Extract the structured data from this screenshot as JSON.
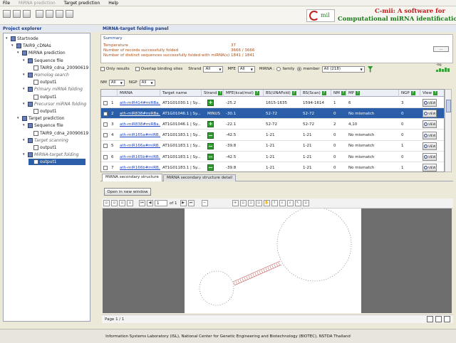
{
  "menu": [
    "File",
    "MiRNA prediction",
    "Target prediction",
    "Help"
  ],
  "menu_disabled": [
    false,
    true,
    false,
    false
  ],
  "toolbar_icons": [
    "new-project-icon",
    "open-project-icon",
    "save-project-icon",
    "document-icon",
    "document-icon",
    "document-icon",
    "document-icon"
  ],
  "logo": {
    "mark_text": "mil",
    "line1": "C-mii: A software for",
    "line2": "Computational miRNA identification"
  },
  "left_panel": {
    "title": "Project explorer",
    "tree": [
      {
        "label": "Startnode",
        "level": 0,
        "type": "folder",
        "twisty": "▾"
      },
      {
        "label": "TAIR9_cDNAs",
        "level": 1,
        "type": "folder",
        "twisty": "▾"
      },
      {
        "label": "MiRNA prediction",
        "level": 2,
        "type": "folder",
        "twisty": "▾"
      },
      {
        "label": "Sequence file",
        "level": 3,
        "type": "folder",
        "twisty": "▾"
      },
      {
        "label": "TAIR9_cdna_20090619",
        "level": 4,
        "type": "file",
        "twisty": ""
      },
      {
        "label": "Homolog search",
        "level": 3,
        "type": "folder",
        "twisty": "▾",
        "italic": true
      },
      {
        "label": "output1",
        "level": 4,
        "type": "file",
        "twisty": ""
      },
      {
        "label": "Primary miRNA folding",
        "level": 3,
        "type": "folder",
        "twisty": "▾",
        "italic": true
      },
      {
        "label": "output1",
        "level": 4,
        "type": "file",
        "twisty": ""
      },
      {
        "label": "Precursor miRNA folding",
        "level": 3,
        "type": "folder",
        "twisty": "▾",
        "italic": true
      },
      {
        "label": "output1",
        "level": 4,
        "type": "file",
        "twisty": ""
      },
      {
        "label": "Target prediction",
        "level": 2,
        "type": "folder",
        "twisty": "▾"
      },
      {
        "label": "Sequence file",
        "level": 3,
        "type": "folder",
        "twisty": "▾"
      },
      {
        "label": "TAIR9_cdna_20090619",
        "level": 4,
        "type": "file",
        "twisty": ""
      },
      {
        "label": "Target scanning",
        "level": 3,
        "type": "folder",
        "twisty": "▾",
        "italic": true
      },
      {
        "label": "output1",
        "level": 4,
        "type": "file",
        "twisty": ""
      },
      {
        "label": "MiRNA-target folding",
        "level": 3,
        "type": "folder",
        "twisty": "▾",
        "italic": true
      },
      {
        "label": "output1",
        "level": 4,
        "type": "file",
        "twisty": "",
        "selected": true
      }
    ]
  },
  "right_panel": {
    "title": "MiRNA-target folding panel",
    "summary": {
      "title": "Summary",
      "rows": [
        {
          "label": "Temperature",
          "value": "37"
        },
        {
          "label": "Number of records successfully folded",
          "value": "3666 / 3666"
        },
        {
          "label": "Number of distinct sequences successfully folded with miRNA(s)",
          "value": "1841 / 1841"
        }
      ],
      "more_button": "..."
    },
    "filters": {
      "only_results": "Only results",
      "overlap": "Overlap binding sites",
      "strand_label": "Strand",
      "strand_value": "All",
      "mfe_label": "MFE",
      "mfe_value": "All",
      "mirna_label": "MiRNA :",
      "family_label": "family",
      "member_label": "member",
      "member_value": "All (218)",
      "nm_label": "NM",
      "nm_value": "All",
      "ngp_label": "NGP",
      "ngp_value": "All",
      "stat_label": "-log"
    },
    "table": {
      "columns": [
        "",
        "MiRNA",
        "Target name",
        "Strand",
        "MFE(kcal/mol)",
        "BS(UNAFold)",
        "BS(Scan)",
        "NM",
        "MP",
        "NGP",
        "View"
      ],
      "rows": [
        {
          "idx": "1",
          "mirna": "ath-miR414#miRBa...",
          "target": "AT1G01030.1 | Sy...",
          "strand": "plus",
          "strand_text": "",
          "mfe": "-25.2",
          "bs_unafold": "1615-1635",
          "bs_scan": "1594-1614",
          "nm": "1",
          "mp": "6",
          "ngp": "3",
          "view": "VIEW"
        },
        {
          "idx": "2",
          "mirna": "ath-miR838#miRBa...",
          "target": "AT1G01046.1 | Sy...",
          "strand": "text",
          "strand_text": "MINUS",
          "mfe": "-30.1",
          "bs_unafold": "52-72",
          "bs_scan": "52-72",
          "nm": "0",
          "mp": "No mismatch",
          "ngp": "0",
          "view": "VIEW",
          "selected": true
        },
        {
          "idx": "3",
          "mirna": "ath-miR838#miRBa...",
          "target": "AT1G01046.1 | Sy...",
          "strand": "plus",
          "strand_text": "",
          "mfe": "-22.1",
          "bs_unafold": "52-72",
          "bs_scan": "52-72",
          "nm": "2",
          "mp": "4,10",
          "ngp": "0",
          "view": "VIEW"
        },
        {
          "idx": "4",
          "mirna": "ath-miR165a#miRB...",
          "target": "AT1G01183.1 | Sy...",
          "strand": "minus",
          "strand_text": "",
          "mfe": "-42.5",
          "bs_unafold": "1-21",
          "bs_scan": "1-21",
          "nm": "0",
          "mp": "No mismatch",
          "ngp": "0",
          "view": "VIEW"
        },
        {
          "idx": "5",
          "mirna": "ath-miR166a#miRB...",
          "target": "AT1G01183.1 | Sy...",
          "strand": "minus",
          "strand_text": "",
          "mfe": "-39.8",
          "bs_unafold": "1-21",
          "bs_scan": "1-21",
          "nm": "0",
          "mp": "No mismatch",
          "ngp": "1",
          "view": "VIEW"
        },
        {
          "idx": "6",
          "mirna": "ath-miR165b#miRB...",
          "target": "AT1G01183.1 | Sy...",
          "strand": "minus",
          "strand_text": "",
          "mfe": "-42.5",
          "bs_unafold": "1-21",
          "bs_scan": "1-21",
          "nm": "0",
          "mp": "No mismatch",
          "ngp": "0",
          "view": "VIEW"
        },
        {
          "idx": "7",
          "mirna": "ath-miR166b#miRB...",
          "target": "AT1G01183.1 | Sy...",
          "strand": "minus",
          "strand_text": "",
          "mfe": "-39.8",
          "bs_unafold": "1-21",
          "bs_scan": "1-21",
          "nm": "0",
          "mp": "No mismatch",
          "ngp": "1",
          "view": "VIEW"
        }
      ]
    },
    "tabs": [
      "MiRNA secondary structure",
      "MiRNA secondary structure detail"
    ],
    "open_button": "Open in new window",
    "viewer": {
      "page_value": "1",
      "page_of": "of 1",
      "status": "Page 1 / 1"
    }
  },
  "footer": "Information Systems Laboratory (ISL), National Center for Genetic Engineering and Biotechnology (BIOTEC), NSTDA Thailand",
  "colors": {
    "accent": "#2a5ea8",
    "summary_text": "#b24d10",
    "strand_green": "#2f9d2f",
    "logo_red": "#c01818",
    "logo_green": "#1a7a1a"
  }
}
